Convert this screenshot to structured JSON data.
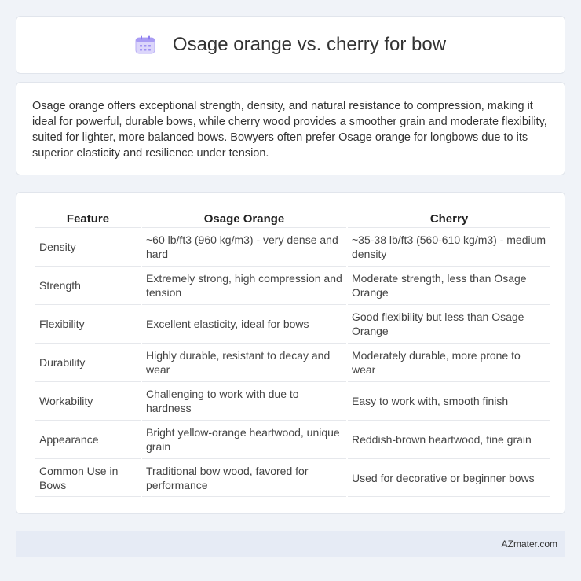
{
  "header": {
    "title": "Osage orange vs. cherry for bow",
    "icon": "calendar-icon"
  },
  "summary": {
    "text": "Osage orange offers exceptional strength, density, and natural resistance to compression, making it ideal for powerful, durable bows, while cherry wood provides a smoother grain and moderate flexibility, suited for lighter, more balanced bows. Bowyers often prefer Osage orange for longbows due to its superior elasticity and resilience under tension."
  },
  "table": {
    "headers": [
      "Feature",
      "Osage Orange",
      "Cherry"
    ],
    "rows": [
      [
        "Density",
        "~60 lb/ft3 (960 kg/m3) - very dense and hard",
        "~35-38 lb/ft3 (560-610 kg/m3) - medium density"
      ],
      [
        "Strength",
        "Extremely strong, high compression and tension",
        "Moderate strength, less than Osage Orange"
      ],
      [
        "Flexibility",
        "Excellent elasticity, ideal for bows",
        "Good flexibility but less than Osage Orange"
      ],
      [
        "Durability",
        "Highly durable, resistant to decay and wear",
        "Moderately durable, more prone to wear"
      ],
      [
        "Workability",
        "Challenging to work with due to hardness",
        "Easy to work with, smooth finish"
      ],
      [
        "Appearance",
        "Bright yellow-orange heartwood, unique grain",
        "Reddish-brown heartwood, fine grain"
      ],
      [
        "Common Use in Bows",
        "Traditional bow wood, favored for performance",
        "Used for decorative or beginner bows"
      ]
    ]
  },
  "footer": {
    "brand": "AZmater.com"
  },
  "colors": {
    "background": "#f0f3f8",
    "card": "#ffffff",
    "footer": "#e6ebf5",
    "icon_accent": "#8b7cf0"
  }
}
